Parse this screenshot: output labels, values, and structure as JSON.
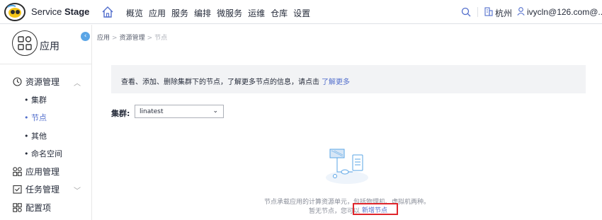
{
  "header": {
    "brand_light": "Service ",
    "brand_bold": "Stage",
    "nav": [
      "概览",
      "应用",
      "服务",
      "编排",
      "微服务",
      "运维",
      "仓库",
      "设置"
    ],
    "region": "杭州",
    "user": "ivycln@126.com@..."
  },
  "sidebar": {
    "app_title": "应用",
    "collapse_icon": "‹",
    "menu": {
      "resources": "资源管理",
      "sub": [
        "集群",
        "节点",
        "其他",
        "命名空间"
      ],
      "app_mgmt": "应用管理",
      "task_mgmt": "任务管理",
      "config": "配置项"
    }
  },
  "breadcrumb": {
    "items": [
      "应用",
      "资源管理",
      "节点"
    ]
  },
  "info": {
    "text": "查看、添加、删除集群下的节点，了解更多节点的信息，请点击",
    "link": "了解更多"
  },
  "cluster": {
    "label": "集群:",
    "selected": "linatest"
  },
  "empty": {
    "line1": "节点承载应用的计算资源单元，包括物理机、虚拟机两种。",
    "line2": "暂无节点，您可以",
    "add_link": "新增节点"
  },
  "colors": {
    "accent": "#526ecc",
    "highlight_border": "#e0262c"
  }
}
